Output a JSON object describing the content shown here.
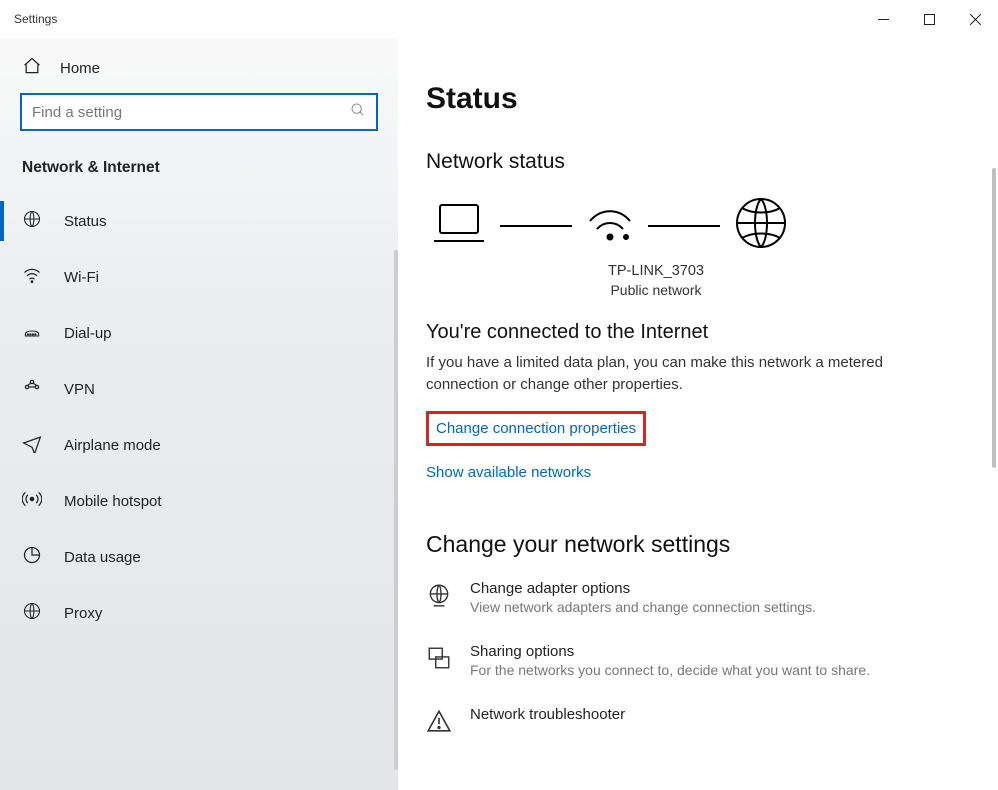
{
  "window": {
    "title": "Settings"
  },
  "sidebar": {
    "home": "Home",
    "search_placeholder": "Find a setting",
    "section": "Network & Internet",
    "items": [
      {
        "label": "Status"
      },
      {
        "label": "Wi-Fi"
      },
      {
        "label": "Dial-up"
      },
      {
        "label": "VPN"
      },
      {
        "label": "Airplane mode"
      },
      {
        "label": "Mobile hotspot"
      },
      {
        "label": "Data usage"
      },
      {
        "label": "Proxy"
      }
    ]
  },
  "content": {
    "title": "Status",
    "network_status_heading": "Network status",
    "network_name": "TP-LINK_3703",
    "network_type": "Public network",
    "connected_heading": "You're connected to the Internet",
    "connected_desc": "If you have a limited data plan, you can make this network a metered connection or change other properties.",
    "link_properties": "Change connection properties",
    "link_available": "Show available networks",
    "change_settings_heading": "Change your network settings",
    "settings": [
      {
        "title": "Change adapter options",
        "desc": "View network adapters and change connection settings."
      },
      {
        "title": "Sharing options",
        "desc": "For the networks you connect to, decide what you want to share."
      },
      {
        "title": "Network troubleshooter",
        "desc": ""
      }
    ]
  }
}
